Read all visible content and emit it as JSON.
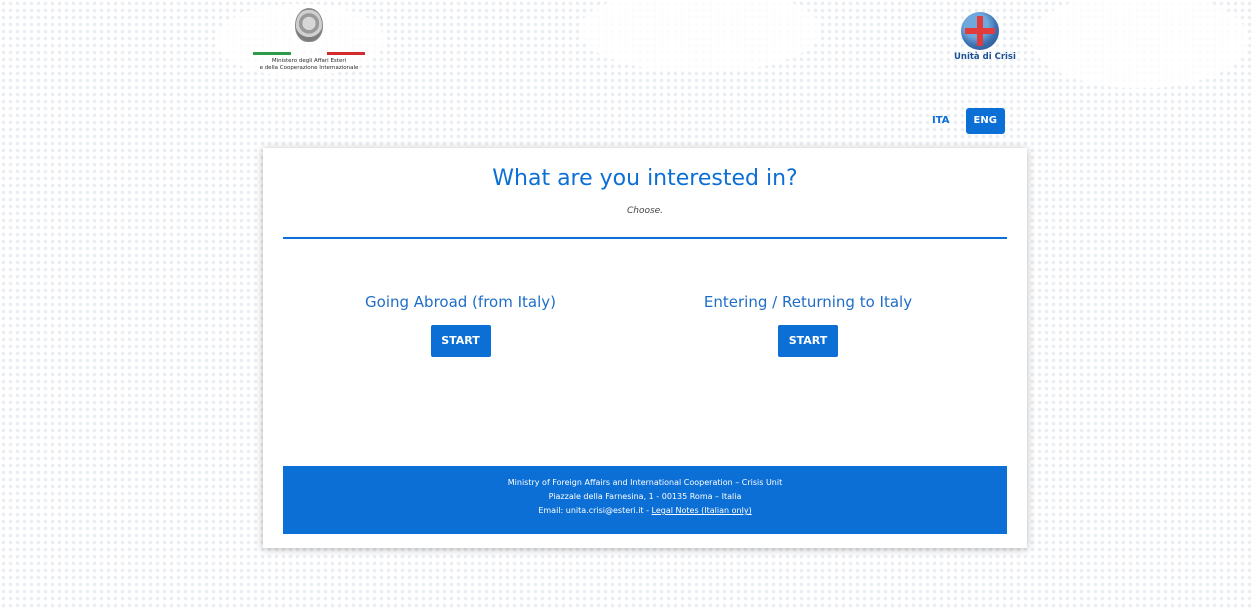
{
  "header": {
    "ministry_logo": {
      "text": "Ministero degli Affari Esteri\ne della Cooperazione Internazionale"
    },
    "crisis_logo": {
      "text": "Unità di Crisi"
    }
  },
  "language": {
    "options": [
      "ITA",
      "ENG"
    ],
    "selected": "ENG"
  },
  "main": {
    "title": "What are you interested in?",
    "subtitle": "Choose.",
    "choices": [
      {
        "label": "Going Abroad (from Italy)",
        "button": "START"
      },
      {
        "label": "Entering / Returning to Italy",
        "button": "START"
      }
    ]
  },
  "footer": {
    "line1": "Ministry of Foreign Affairs and International Cooperation – Crisis Unit",
    "line2": "Piazzale della Farnesina, 1 - 00135 Roma – Italia",
    "email_prefix": "Email: unita.crisi@esteri.it - ",
    "legal_link": "Legal Notes (Italian only)"
  },
  "colors": {
    "accent": "#0b6fd6",
    "flag_green": "#2e9b48",
    "flag_red": "#d32b2b"
  },
  "icons": [
    "italian-republic-emblem-icon",
    "crisis-unit-globe-icon"
  ]
}
